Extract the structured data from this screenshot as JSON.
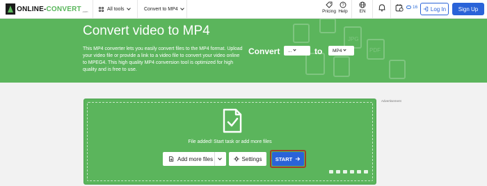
{
  "header": {
    "logo_main": "ONLINE-",
    "logo_accent": "CONVERT",
    "logo_suffix": ".com",
    "all_tools": "All tools",
    "convert_to": "Convert to MP4",
    "pricing": "Pricing",
    "help": "Help",
    "language": "EN",
    "credits": "16",
    "login": "Log In",
    "signup": "Sign Up"
  },
  "hero": {
    "title": "Convert video to MP4",
    "description": "This MP4 converter lets you easily convert files to the MP4 format. Upload your video file or provide a link to a video file to convert your video online to MPEG4. This high quality MP4 conversion tool is optimized for high quality and is free to use.",
    "convert_label": "Convert",
    "from_value": "...",
    "to_label": "to",
    "to_value": "MP4"
  },
  "ad_label": "Advertisement",
  "upload": {
    "status": "File added! Start task or add more files",
    "add_more": "Add more files",
    "settings": "Settings",
    "start": "START"
  },
  "colors": {
    "brand_green": "#5bb55c",
    "primary_blue": "#2a63d8",
    "start_outline": "#a04126"
  }
}
